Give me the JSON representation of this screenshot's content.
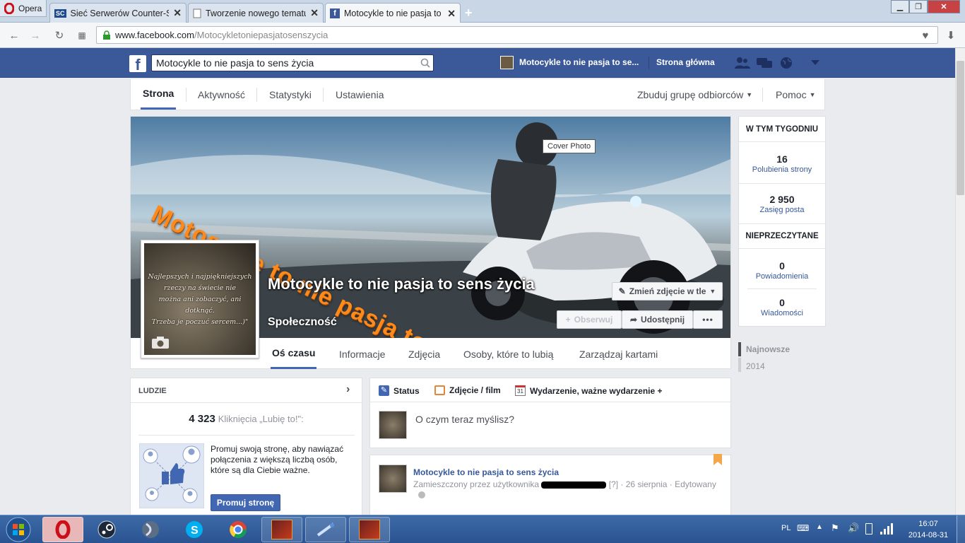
{
  "browser": {
    "opera_label": "Opera",
    "tabs": [
      {
        "title": "Sieć Serwerów Counter-Strike",
        "favicon": "SC"
      },
      {
        "title": "Tworzenie nowego tematu",
        "favicon": ""
      },
      {
        "title": "Motocykle to nie pasja to sens życia",
        "favicon": "f"
      }
    ],
    "url_domain": "www.facebook.com",
    "url_path": "/Motocykletoniepasjatosenszycia"
  },
  "fbbar": {
    "search_value": "Motocykle to nie pasja to sens życia",
    "page_shortcut": "Motocykle to nie pasja to se...",
    "home": "Strona główna"
  },
  "pagemenu": {
    "items": [
      "Strona",
      "Aktywność",
      "Statystyki",
      "Ustawienia"
    ],
    "right": [
      "Zbuduj grupę odbiorców",
      "Pomoc"
    ]
  },
  "cover": {
    "overlay_text": "Motocykle to nie pasja to sens życia",
    "tooltip": "Cover Photo",
    "page_name": "Motocykle to nie pasja to sens życia",
    "category": "Społeczność",
    "change_cover": "Zmień zdjęcie w tle",
    "follow": "Obserwuj",
    "share": "Udostępnij",
    "more": "•••",
    "profile_quote": [
      "Najlepszych i najpiękniejszych",
      "rzeczy na świecie nie",
      "można ani zobaczyć, ani dotknąć.",
      "Trzeba je poczuć sercem...)\""
    ],
    "tabs": [
      "Oś czasu",
      "Informacje",
      "Zdjęcia",
      "Osoby, które to lubią",
      "Zarządzaj kartami"
    ]
  },
  "sidebar_right": {
    "this_week": "W TYM TYGODNIU",
    "likes_num": "16",
    "likes_lbl": "Polubienia strony",
    "reach_num": "2 950",
    "reach_lbl": "Zasięg posta",
    "unread": "NIEPRZECZYTANE",
    "notif_num": "0",
    "notif_lbl": "Powiadomienia",
    "msg_num": "0",
    "msg_lbl": "Wiadomości",
    "timeline_nav": [
      "Najnowsze",
      "2014"
    ]
  },
  "people": {
    "header": "LUDZIE",
    "likes_count": "4 323",
    "likes_label": "Kliknięcia „Lubię to!\":",
    "promo_text": "Promuj swoją stronę, aby nawiązać połączenia z większą liczbą osób, które są dla Ciebie ważne.",
    "promo_button": "Promuj stronę"
  },
  "composer": {
    "tabs": [
      "Status",
      "Zdjęcie / film",
      "Wydarzenie, ważne wydarzenie +"
    ],
    "calendar_day": "31",
    "placeholder": "O czym teraz myślisz?"
  },
  "post": {
    "author": "Motocykle to nie pasja to sens życia",
    "posted_by": "Zamieszczony przez użytkownika",
    "meta": "[?] · 26 sierpnia · Edytowany"
  },
  "taskbar": {
    "lang": "PL",
    "time": "16:07",
    "date": "2014-08-31"
  },
  "colors": {
    "fb_blue": "#3b5998",
    "link": "#365899",
    "cover_text": "#ff8a1c",
    "taskbar": "#2a5392"
  }
}
